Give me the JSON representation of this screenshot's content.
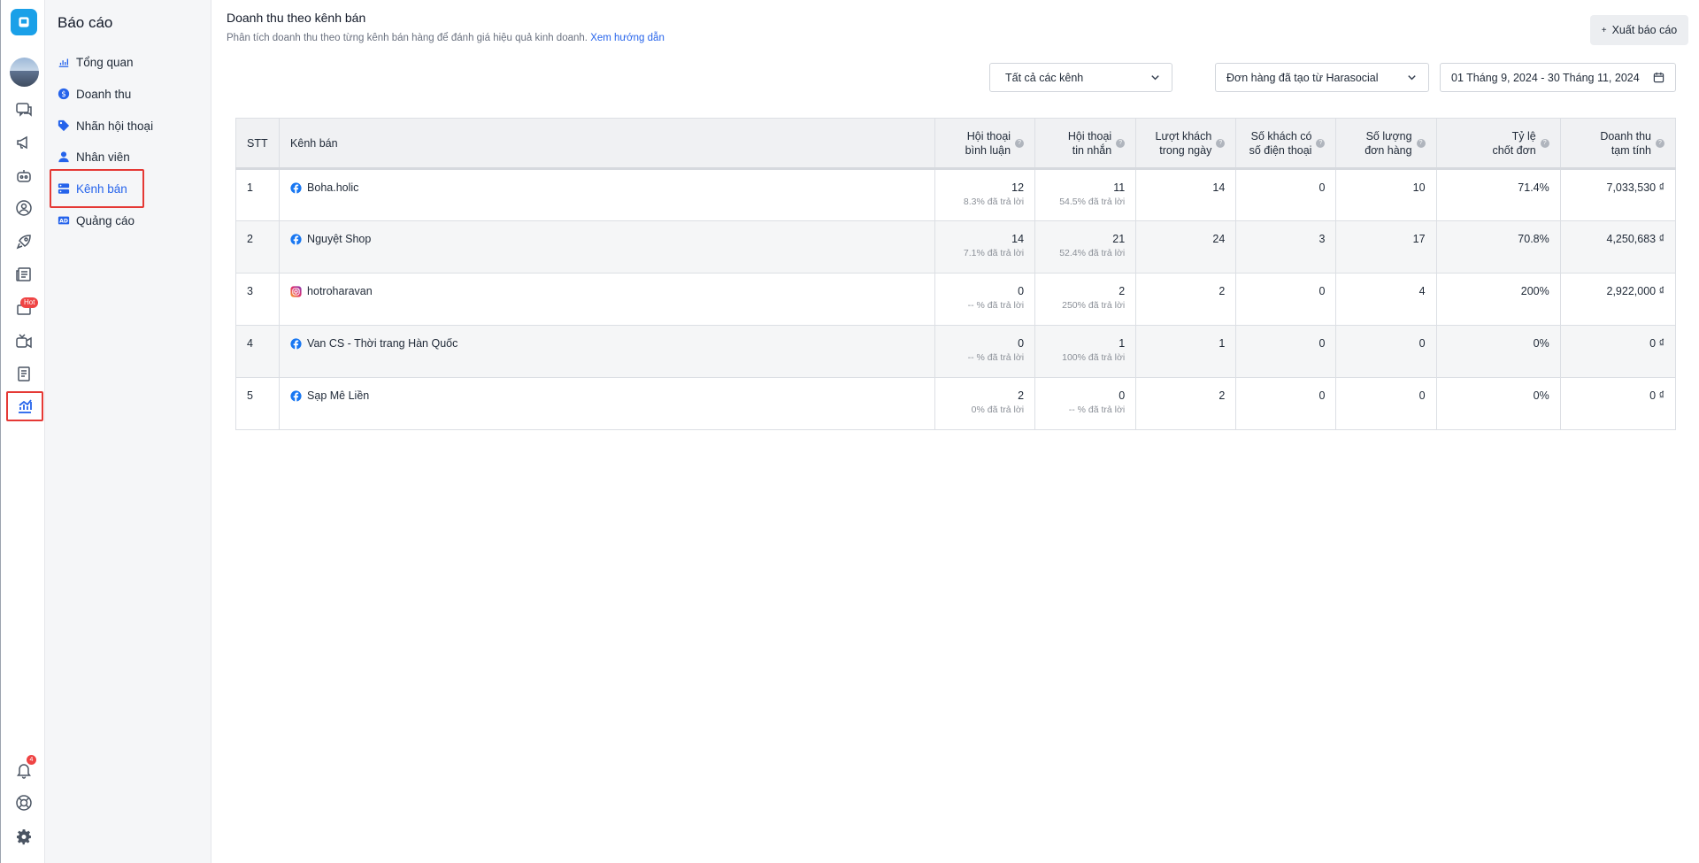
{
  "rail": {
    "hot_label": "Hot",
    "notif_count": "4"
  },
  "sidebar": {
    "title": "Báo cáo",
    "items": [
      {
        "label": "Tổng quan",
        "icon": "chart-icon"
      },
      {
        "label": "Doanh thu",
        "icon": "dollar-icon"
      },
      {
        "label": "Nhãn hội thoại",
        "icon": "tag-icon"
      },
      {
        "label": "Nhân viên",
        "icon": "user-icon"
      },
      {
        "label": "Kênh bán",
        "icon": "channel-icon",
        "active": true
      },
      {
        "label": "Quảng cáo",
        "icon": "ad-icon"
      }
    ]
  },
  "header": {
    "title": "Doanh thu theo kênh bán",
    "description": "Phân tích doanh thu theo từng kênh bán hàng để đánh giá hiệu quả kinh doanh.",
    "guide_link": "Xem hướng dẫn",
    "export_label": "Xuất báo cáo"
  },
  "filters": {
    "channel": "Tất cả các kênh",
    "order_source": "Đơn hàng đã tạo từ Harasocial",
    "date_range": "01 Tháng 9, 2024 - 30 Tháng 11, 2024"
  },
  "table": {
    "headers": {
      "stt": "STT",
      "channel": "Kênh bán",
      "comments_l1": "Hội thoại",
      "comments_l2": "bình luận",
      "messages_l1": "Hội thoại",
      "messages_l2": "tin nhắn",
      "visits_l1": "Lượt khách",
      "visits_l2": "trong ngày",
      "phones_l1": "Số khách có",
      "phones_l2": "số điện thoại",
      "orders_l1": "Số lượng",
      "orders_l2": "đơn hàng",
      "rate_l1": "Tỷ lệ",
      "rate_l2": "chốt đơn",
      "revenue_l1": "Doanh thu",
      "revenue_l2": "tạm tính"
    },
    "rows": [
      {
        "stt": "1",
        "channel": "Boha.holic",
        "platform": "facebook",
        "comments": "12",
        "comments_sub": "8.3% đã trả lời",
        "messages": "11",
        "messages_sub": "54.5% đã trả lời",
        "visits": "14",
        "phones": "0",
        "orders": "10",
        "rate": "71.4%",
        "revenue": "7,033,530 ₫"
      },
      {
        "stt": "2",
        "channel": "Nguyệt Shop",
        "platform": "facebook",
        "comments": "14",
        "comments_sub": "7.1% đã trả lời",
        "messages": "21",
        "messages_sub": "52.4% đã trả lời",
        "visits": "24",
        "phones": "3",
        "orders": "17",
        "rate": "70.8%",
        "revenue": "4,250,683 ₫"
      },
      {
        "stt": "3",
        "channel": "hotroharavan",
        "platform": "instagram",
        "comments": "0",
        "comments_sub": "-- % đã trả lời",
        "messages": "2",
        "messages_sub": "250% đã trả lời",
        "visits": "2",
        "phones": "0",
        "orders": "4",
        "rate": "200%",
        "revenue": "2,922,000 ₫"
      },
      {
        "stt": "4",
        "channel": "Van CS - Thời trang Hàn Quốc",
        "platform": "facebook",
        "comments": "0",
        "comments_sub": "-- % đã trả lời",
        "messages": "1",
        "messages_sub": "100% đã trả lời",
        "visits": "1",
        "phones": "0",
        "orders": "0",
        "rate": "0%",
        "revenue": "0 ₫"
      },
      {
        "stt": "5",
        "channel": "Sạp Mê Liền",
        "platform": "facebook",
        "comments": "2",
        "comments_sub": "0% đã trả lời",
        "messages": "0",
        "messages_sub": "-- % đã trả lời",
        "visits": "2",
        "phones": "0",
        "orders": "0",
        "rate": "0%",
        "revenue": "0 ₫"
      }
    ]
  },
  "colors": {
    "accent": "#2563eb",
    "highlight": "#e53935",
    "facebook": "#1877f2",
    "instagram": "#e1306c"
  }
}
